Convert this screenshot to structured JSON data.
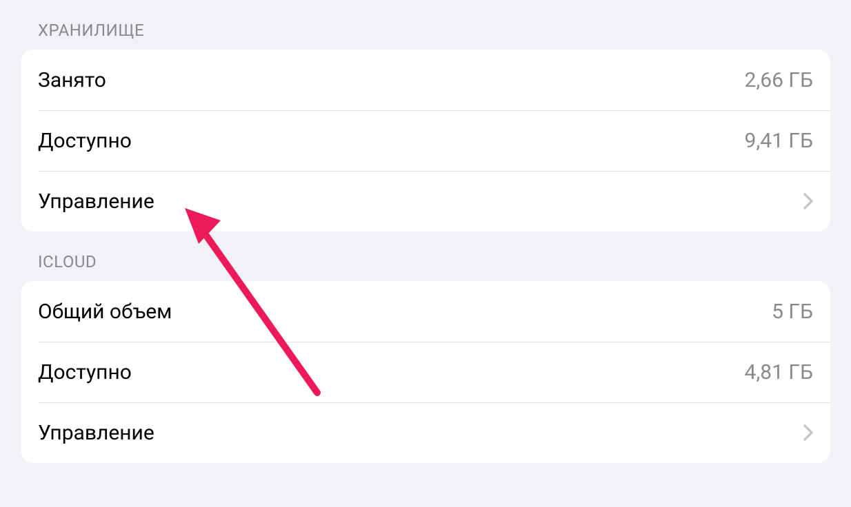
{
  "storage": {
    "header": "ХРАНИЛИЩЕ",
    "used_label": "Занято",
    "used_value": "2,66 ГБ",
    "available_label": "Доступно",
    "available_value": "9,41 ГБ",
    "manage_label": "Управление"
  },
  "icloud": {
    "header": "ICLOUD",
    "total_label": "Общий объем",
    "total_value": "5 ГБ",
    "available_label": "Доступно",
    "available_value": "4,81 ГБ",
    "manage_label": "Управление"
  },
  "colors": {
    "arrow": "#ed1a5b"
  }
}
